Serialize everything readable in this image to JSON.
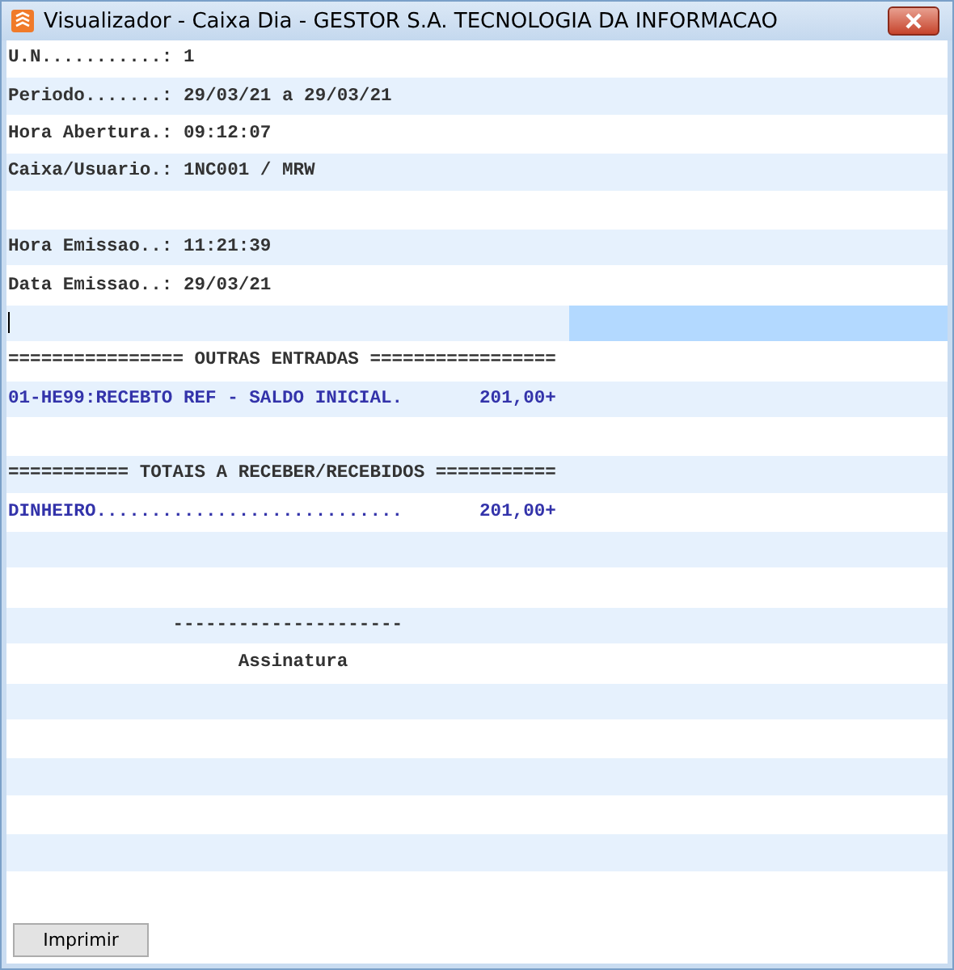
{
  "window": {
    "title": "Visualizador - Caixa Dia - GESTOR S.A. TECNOLOGIA DA INFORMACAO"
  },
  "rows": [
    {
      "text": "U.N...........: 1",
      "color": "#333333",
      "selected": false
    },
    {
      "text": "Periodo.......: 29/03/21 a 29/03/21",
      "color": "#333333",
      "selected": false
    },
    {
      "text": "Hora Abertura.: 09:12:07",
      "color": "#333333",
      "selected": false
    },
    {
      "text": "Caixa/Usuario.: 1NC001 / MRW",
      "color": "#333333",
      "selected": false
    },
    {
      "selected": false
    },
    {
      "text": "Hora Emissao..: 11:21:39",
      "color": "#333333",
      "selected": false
    },
    {
      "text": "Data Emissao..: 29/03/21",
      "color": "#333333",
      "selected": false
    },
    {
      "selected": true
    },
    {
      "text": "================ OUTRAS ENTRADAS =================",
      "color": "#333333",
      "selected": false
    },
    {
      "text": "01-HE99:RECEBTO REF - SALDO INICIAL.       201,00+",
      "color": "#3333aa",
      "selected": false
    },
    {
      "selected": false
    },
    {
      "text": "=========== TOTAIS A RECEBER/RECEBIDOS ===========",
      "color": "#333333",
      "selected": false
    },
    {
      "text": "DINHEIRO............................       201,00+",
      "color": "#3333aa",
      "selected": false
    },
    {
      "selected": false
    },
    {
      "selected": false
    },
    {
      "text": "               ---------------------",
      "color": "#333333",
      "selected": false
    },
    {
      "text": "                     Assinatura",
      "color": "#333333",
      "selected": false
    },
    {
      "selected": false
    },
    {
      "selected": false
    },
    {
      "selected": false
    },
    {
      "selected": false
    },
    {
      "selected": false
    },
    {
      "selected": false
    }
  ],
  "buttons": [
    {
      "label": "Imprimir"
    }
  ]
}
